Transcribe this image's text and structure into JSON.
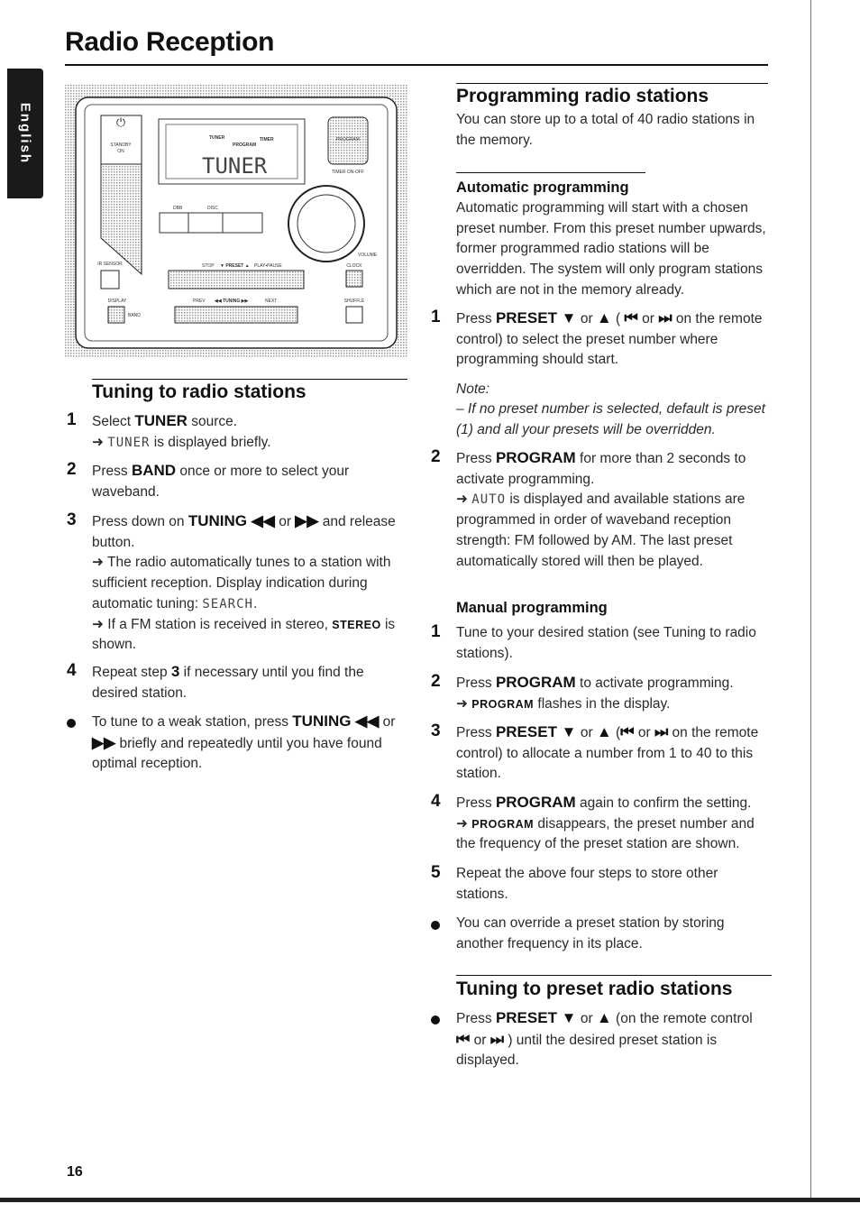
{
  "page": {
    "title": "Radio Reception",
    "side_tab": "English",
    "page_number": "16"
  },
  "device": {
    "display_text": "TUNER",
    "labels": {
      "standby": "STANDBY",
      "on": "ON",
      "program": "PROGRAM",
      "timer_onoff": "TIMER ON-OFF",
      "tuner_ind": "TUNER",
      "program_ind": "PROGRAM",
      "timer_ind": "TIMER",
      "cd": "DBB",
      "disc": "DISC",
      "volume": "VOLUME",
      "ir_sensor": "IR SENSOR",
      "stop": "STOP",
      "preset": "▼ PRESET ▲",
      "play_pause": "PLAY•PAUSE",
      "clock": "CLOCK",
      "display": "DISPLAY",
      "band": "BAND",
      "prev": "PREV",
      "tuning": "◀◀ TUNING ▶▶",
      "next": "NEXT",
      "shuffle": "SHUFFLE"
    }
  },
  "left": {
    "heading": "Tuning to radio stations",
    "steps": [
      {
        "marker": "1",
        "paras": [
          [
            {
              "t": "Select "
            },
            {
              "t": "TUNER",
              "s": "b"
            },
            {
              "t": " source."
            }
          ],
          [
            {
              "t": "➜ "
            },
            {
              "t": "TUNER",
              "s": "lcd"
            },
            {
              "t": " is displayed briefly."
            }
          ]
        ]
      },
      {
        "marker": "2",
        "paras": [
          [
            {
              "t": "Press "
            },
            {
              "t": "BAND",
              "s": "b"
            },
            {
              "t": " once or more to select your waveband."
            }
          ]
        ]
      },
      {
        "marker": "3",
        "paras": [
          [
            {
              "t": "Press down on "
            },
            {
              "t": "TUNING ◀◀",
              "s": "b"
            },
            {
              "t": " or "
            },
            {
              "t": "▶▶",
              "s": "b"
            },
            {
              "t": " and release button."
            }
          ],
          [
            {
              "t": "➜ The radio automatically tunes to a station with sufficient reception. Display indication during automatic tuning: "
            },
            {
              "t": "SEARCH",
              "s": "lcd"
            },
            {
              "t": "."
            }
          ],
          [
            {
              "t": "➜ If a FM station is received in stereo, "
            },
            {
              "t": "STEREO",
              "s": "sc"
            },
            {
              "t": " is shown."
            }
          ]
        ]
      },
      {
        "marker": "4",
        "paras": [
          [
            {
              "t": "Repeat step "
            },
            {
              "t": "3",
              "s": "b"
            },
            {
              "t": " if necessary until you find the desired station."
            }
          ]
        ]
      },
      {
        "marker": "•",
        "paras": [
          [
            {
              "t": "To tune to a weak station, press "
            },
            {
              "t": "TUNING ◀◀",
              "s": "b"
            },
            {
              "t": " or "
            },
            {
              "t": "▶▶",
              "s": "b"
            },
            {
              "t": " briefly and repeatedly until you have found optimal reception."
            }
          ]
        ]
      }
    ]
  },
  "right": {
    "heading": "Programming radio stations",
    "intro": "You can store up to a total of 40 radio stations in the memory.",
    "auto": {
      "heading": "Automatic programming",
      "intro": "Automatic programming will start with a chosen preset number. From this preset number upwards, former programmed radio stations will be overridden. The system will only program stations which are not in the memory already.",
      "step1": {
        "marker": "1",
        "paras": [
          [
            {
              "t": "Press "
            },
            {
              "t": "PRESET ▼",
              "s": "b"
            },
            {
              "t": " or "
            },
            {
              "t": "▲",
              "s": "b"
            },
            {
              "t": " ( "
            },
            {
              "t": "⏮",
              "s": "b"
            },
            {
              "t": " or "
            },
            {
              "t": "⏭",
              "s": "b"
            },
            {
              "t": " on the remote control) to select the preset number where programming should start."
            }
          ]
        ]
      },
      "note_label": "Note:",
      "note_text": "– If no preset number is selected, default is preset (1) and all your presets will be overridden.",
      "step2": {
        "marker": "2",
        "paras": [
          [
            {
              "t": "Press "
            },
            {
              "t": "PROGRAM",
              "s": "b"
            },
            {
              "t": " for more than 2 seconds to activate programming."
            }
          ],
          [
            {
              "t": "➜ "
            },
            {
              "t": "AUTO",
              "s": "lcd"
            },
            {
              "t": " is displayed and available stations are programmed in order of waveband reception strength: FM followed by AM. The last preset automatically stored will then be played."
            }
          ]
        ]
      }
    },
    "manual": {
      "heading": "Manual programming",
      "steps": [
        {
          "marker": "1",
          "paras": [
            [
              {
                "t": "Tune to your desired station (see Tuning to radio stations)."
              }
            ]
          ]
        },
        {
          "marker": "2",
          "paras": [
            [
              {
                "t": "Press "
              },
              {
                "t": "PROGRAM",
                "s": "b"
              },
              {
                "t": " to activate programming."
              }
            ],
            [
              {
                "t": "➜ "
              },
              {
                "t": "PROGRAM",
                "s": "sc"
              },
              {
                "t": " flashes in the display."
              }
            ]
          ]
        },
        {
          "marker": "3",
          "paras": [
            [
              {
                "t": "Press "
              },
              {
                "t": "PRESET ▼",
                "s": "b"
              },
              {
                "t": " or "
              },
              {
                "t": "▲",
                "s": "b"
              },
              {
                "t": " ("
              },
              {
                "t": "⏮",
                "s": "b"
              },
              {
                "t": " or "
              },
              {
                "t": "⏭",
                "s": "b"
              },
              {
                "t": " on the remote control) to allocate a number from 1 to 40 to this station."
              }
            ]
          ]
        },
        {
          "marker": "4",
          "paras": [
            [
              {
                "t": "Press "
              },
              {
                "t": "PROGRAM",
                "s": "b"
              },
              {
                "t": " again to confirm the setting."
              }
            ],
            [
              {
                "t": "➜ "
              },
              {
                "t": "PROGRAM",
                "s": "sc"
              },
              {
                "t": " disappears, the preset number and the frequency of the preset station are shown."
              }
            ]
          ]
        },
        {
          "marker": "5",
          "paras": [
            [
              {
                "t": "Repeat the above four steps to store other stations."
              }
            ]
          ]
        },
        {
          "marker": "•",
          "paras": [
            [
              {
                "t": "You can override a preset station by storing another frequency in its place."
              }
            ]
          ]
        }
      ]
    },
    "preset": {
      "heading": "Tuning to preset radio stations",
      "steps": [
        {
          "marker": "•",
          "paras": [
            [
              {
                "t": "Press "
              },
              {
                "t": "PRESET ▼",
                "s": "b"
              },
              {
                "t": " or "
              },
              {
                "t": "▲",
                "s": "b"
              },
              {
                "t": " (on the remote control "
              },
              {
                "t": "⏮",
                "s": "b"
              },
              {
                "t": " or "
              },
              {
                "t": "⏭",
                "s": "b"
              },
              {
                "t": " ) until the desired preset station is displayed."
              }
            ]
          ]
        }
      ]
    }
  }
}
